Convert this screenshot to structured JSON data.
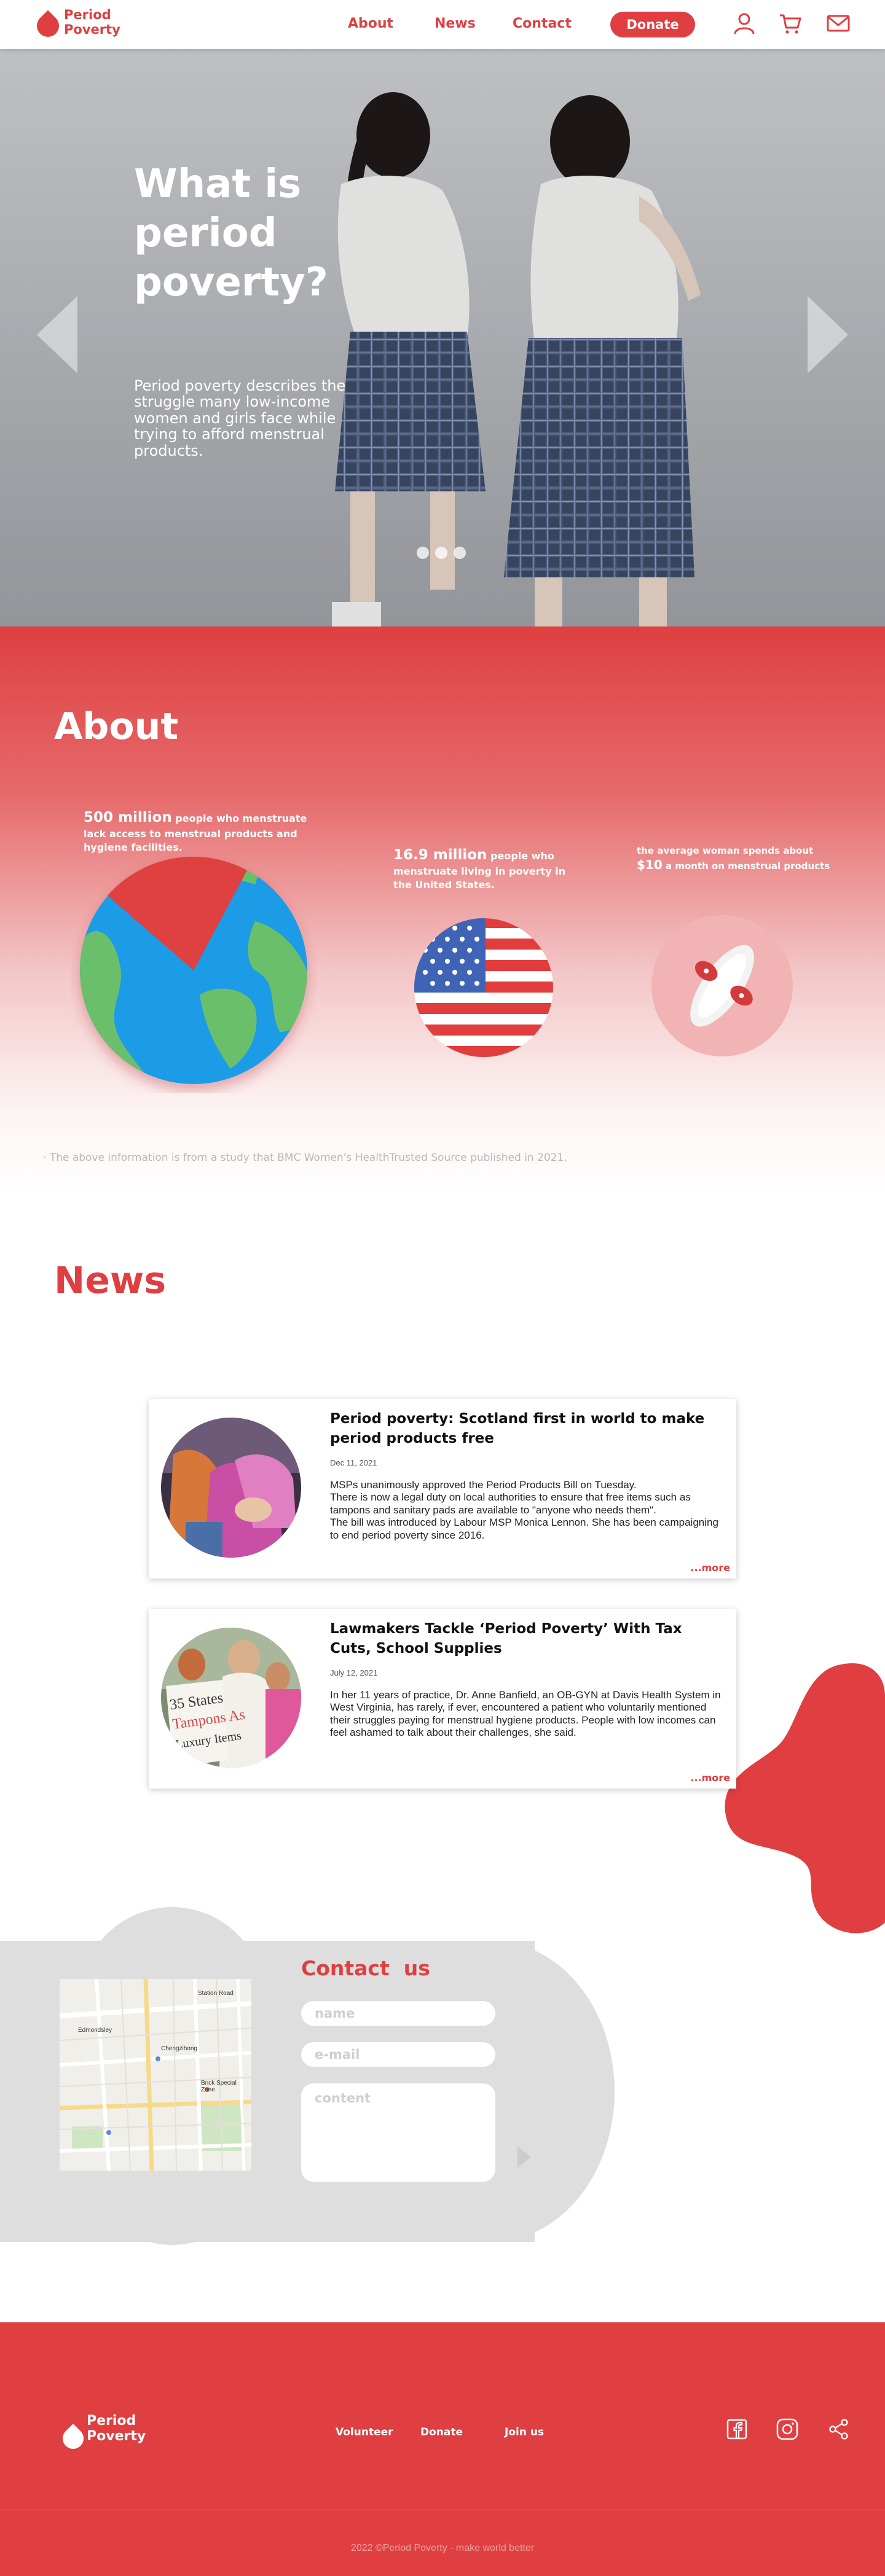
{
  "colors": {
    "brand_red": "#df3f41",
    "contact_grey": "#dedede",
    "note_grey": "#b8b8b8"
  },
  "header": {
    "logo_line1": "Period",
    "logo_line2": "Poverty",
    "nav": [
      "About",
      "News",
      "Contact"
    ],
    "donate_label": "Donate",
    "icons": [
      "user-icon",
      "cart-icon",
      "mail-icon"
    ]
  },
  "hero": {
    "title": "What is period poverty?",
    "text": "Period poverty describes the struggle many low-income women and girls face while trying to afford menstrual products.",
    "slide_count": 3,
    "active_slide": 1,
    "icons": [
      "arrow-left-icon",
      "arrow-right-icon"
    ]
  },
  "about": {
    "title": "About",
    "stat1": {
      "highlight": "500 million",
      "text": "people who menstruate lack access to menstrual products and hygiene facilities."
    },
    "stat2": {
      "highlight": "16.9 million",
      "text": "people who menstruate living in poverty in the United States."
    },
    "stat3": {
      "prefix": "the average woman spends about",
      "highlight": "$10",
      "suffix": "a month on menstrual products"
    },
    "source_note": "· The above information is from a study that BMC Women's HealthTrusted Source published in 2021."
  },
  "news": {
    "title": "News",
    "items": [
      {
        "title": "Period poverty: Scotland first in world to make period products free",
        "date": "Dec 11, 2021",
        "body": "MSPs unanimously approved the Period Products Bill on Tuesday.\nThere is now a legal duty on local authorities to ensure that free items such as tampons and sanitary pads are available to \"anyone who needs them\".\nThe bill was introduced by Labour MSP Monica Lennon. She has been campaigning to end period poverty since 2016.",
        "more": "...more"
      },
      {
        "title": "Lawmakers Tackle ‘Period Poverty’ With Tax Cuts, School Supplies",
        "date": "July 12, 2021",
        "body": "In her 11 years of practice, Dr. Anne Banfield, an OB-GYN at Davis Health System in West Virginia, has rarely, if ever, encountered a patient who voluntarily mentioned their struggles paying for menstrual hygiene products. People with low incomes can feel ashamed to talk about their challenges, she said.",
        "more": "...more"
      }
    ]
  },
  "contact": {
    "title": "Contact  us",
    "name_placeholder": "name",
    "email_placeholder": "e-mail",
    "content_placeholder": "content",
    "map_labels": [
      "Station Road",
      "Edmondsley",
      "Chengzihong",
      "Brick Special Zone"
    ]
  },
  "footer": {
    "logo_line1": "Period",
    "logo_line2": "Poverty",
    "links": [
      "Volunteer",
      "Donate",
      "Join us"
    ],
    "icons": [
      "facebook-icon",
      "instagram-icon",
      "share-icon"
    ],
    "copyright": "2022 ©Period Poverty - make world better"
  }
}
